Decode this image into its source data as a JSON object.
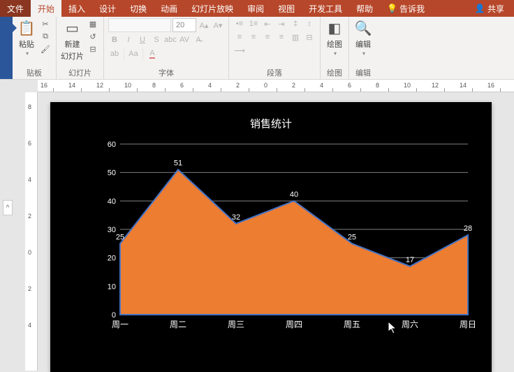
{
  "tabs": {
    "file": "文件",
    "home": "开始",
    "insert": "插入",
    "design": "设计",
    "transition": "切换",
    "animation": "动画",
    "slideshow": "幻灯片放映",
    "review": "审阅",
    "view": "视图",
    "developer": "开发工具",
    "help": "帮助",
    "tellme": "告诉我",
    "share": "共享"
  },
  "ribbon": {
    "clipboard": {
      "paste": "粘贴",
      "label": "贴板"
    },
    "slides": {
      "new": "新建",
      "new2": "幻灯片",
      "label": "幻灯片"
    },
    "font": {
      "size": "20",
      "label": "字体"
    },
    "paragraph": {
      "label": "段落"
    },
    "drawing": {
      "btn": "绘图",
      "label": "绘图"
    },
    "editing": {
      "btn": "编辑",
      "label": "编辑"
    }
  },
  "ruler": {
    "h": [
      "16",
      "14",
      "12",
      "10",
      "8",
      "6",
      "4",
      "2",
      "0",
      "2",
      "4",
      "6",
      "8",
      "10",
      "12",
      "14",
      "16"
    ],
    "v": [
      "8",
      "6",
      "4",
      "2",
      "0",
      "2",
      "4"
    ]
  },
  "chart_data": {
    "type": "area",
    "title": "销售统计",
    "categories": [
      "周一",
      "周二",
      "周三",
      "周四",
      "周五",
      "周六",
      "周日"
    ],
    "values": [
      25,
      51,
      32,
      40,
      25,
      17,
      28
    ],
    "ylim": [
      0,
      60
    ],
    "ystep": 10,
    "xlabel": "",
    "ylabel": ""
  }
}
